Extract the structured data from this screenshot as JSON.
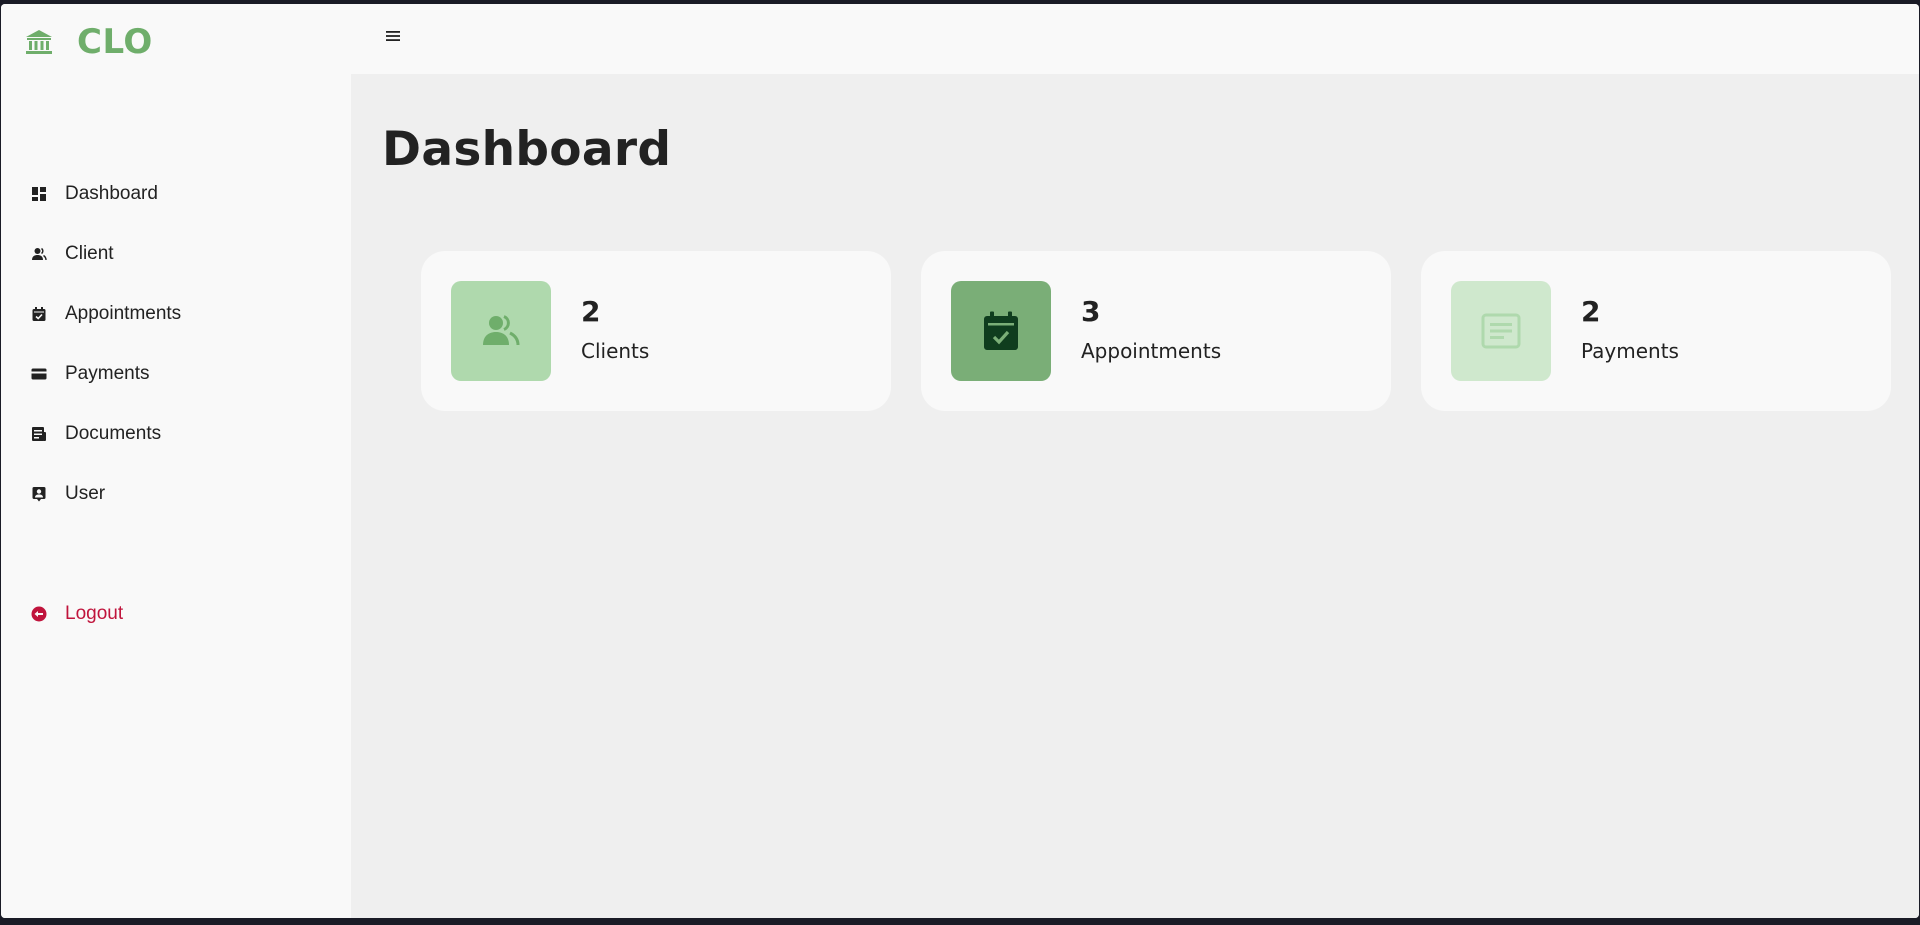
{
  "brand": {
    "name": "CLO",
    "icon": "bank-icon"
  },
  "colors": {
    "brand": "#6fae6b",
    "logout": "#c0143c",
    "card_clients_bg": "#afd9ad",
    "card_appointments_bg": "#7aae77",
    "card_payments_bg": "#cfe8cd"
  },
  "sidebar": {
    "items": [
      {
        "label": "Dashboard",
        "icon": "dashboard-icon"
      },
      {
        "label": "Client",
        "icon": "client-icon"
      },
      {
        "label": "Appointments",
        "icon": "calendar-check-icon"
      },
      {
        "label": "Payments",
        "icon": "credit-card-icon"
      },
      {
        "label": "Documents",
        "icon": "document-icon"
      },
      {
        "label": "User",
        "icon": "user-badge-icon"
      }
    ],
    "logout": {
      "label": "Logout",
      "icon": "logout-icon"
    }
  },
  "topbar": {
    "menu_icon": "hamburger-icon"
  },
  "main": {
    "title": "Dashboard",
    "cards": [
      {
        "count": "2",
        "label": "Clients",
        "icon": "users-icon"
      },
      {
        "count": "3",
        "label": "Appointments",
        "icon": "calendar-check-icon"
      },
      {
        "count": "2",
        "label": "Payments",
        "icon": "document-icon"
      }
    ]
  }
}
